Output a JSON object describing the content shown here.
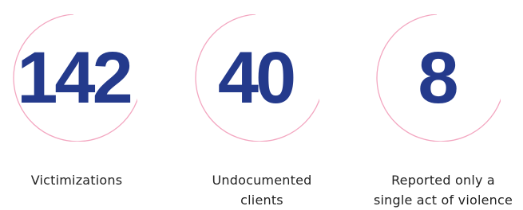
{
  "stats": [
    {
      "value": "142",
      "label": "Victimizations"
    },
    {
      "value": "40",
      "label": "Undocumented\nclients"
    },
    {
      "value": "8",
      "label": "Reported only a\nsingle act of violence"
    }
  ],
  "colors": {
    "number": "#243a8c",
    "ring": "#f3a6c0",
    "label": "#222222",
    "background": "#ffffff"
  }
}
